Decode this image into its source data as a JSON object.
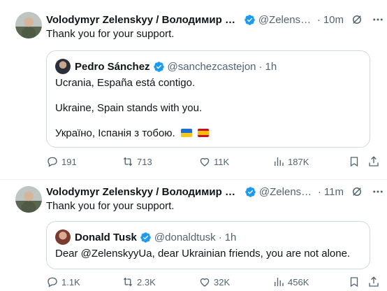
{
  "tweets": [
    {
      "author_name": "Volodymyr Zelenskyy / Володимир Зеленський",
      "handle": "@ZelenskyyUa",
      "time": "10m",
      "text": "Thank you for your support.",
      "quote": {
        "author_name": "Pedro Sánchez",
        "handle": "@sanchezcastejon",
        "time": "1h",
        "lines": [
          "Ucrania, España está contigo.",
          "Ukraine, Spain stands with you.",
          "Україно, Іспанія з тобою."
        ]
      },
      "stats": {
        "replies": "191",
        "reposts": "713",
        "likes": "11K",
        "views": "187K"
      }
    },
    {
      "author_name": "Volodymyr Zelenskyy / Володимир Зеленський",
      "handle": "@ZelenskyyUa",
      "time": "11m",
      "text": "Thank you for your support.",
      "quote": {
        "author_name": "Donald Tusk",
        "handle": "@donaldtusk",
        "time": "1h",
        "lines": [
          "Dear @ZelenskyyUa, dear Ukrainian friends, you are not alone."
        ]
      },
      "stats": {
        "replies": "1.1K",
        "reposts": "2.3K",
        "likes": "32K",
        "views": "456K"
      }
    }
  ],
  "separator": "·",
  "colors": {
    "verified": "#1d9bf0",
    "secondary_text": "#536471",
    "border": "#cfd9de"
  },
  "icons": [
    "verified-badge-icon",
    "grok-icon",
    "more-icon",
    "reply-icon",
    "repost-icon",
    "like-icon",
    "views-icon",
    "bookmark-icon",
    "share-icon",
    "flag-ukraine-icon",
    "flag-spain-icon"
  ]
}
